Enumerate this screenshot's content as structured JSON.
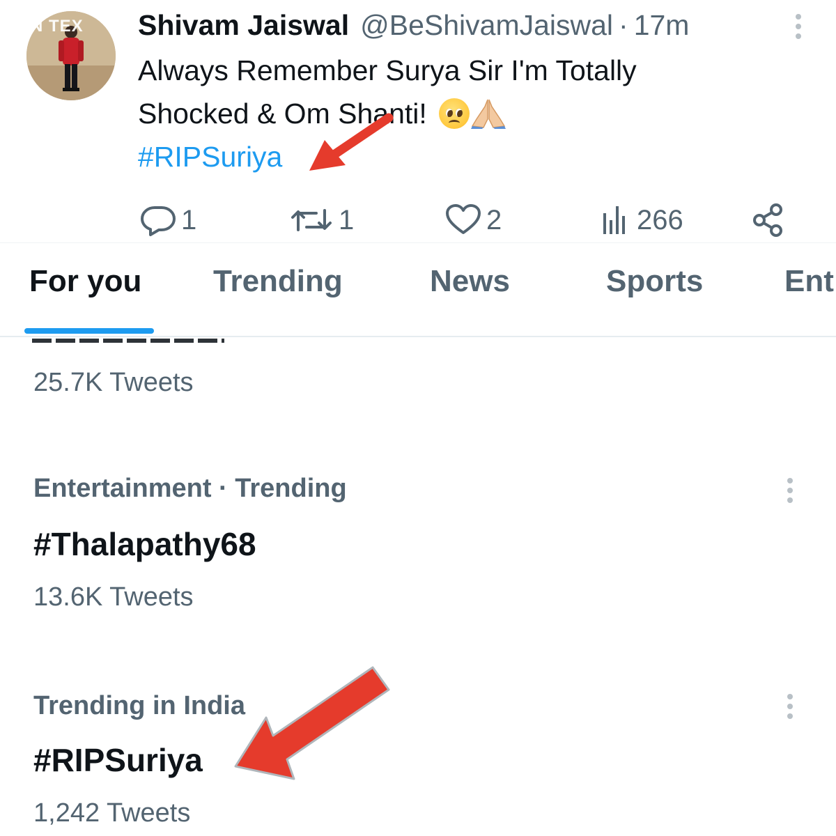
{
  "watermark": "N TEX",
  "tweet": {
    "author_name": "Shivam Jaiswal",
    "author_handle": "@BeShivamJaiswal",
    "separator": "·",
    "time_ago": "17m",
    "text_line_1": "Always Remember Surya Sir I'm Totally",
    "text_line_2": "Shocked & Om Shanti!",
    "hashtag": "#RIPSuriya",
    "emojis": [
      "pleading-face",
      "folded-hands"
    ],
    "replies": "1",
    "retweets": "1",
    "likes": "2",
    "views": "266"
  },
  "tabs": {
    "items": [
      {
        "label": "For you",
        "active": true
      },
      {
        "label": "Trending",
        "active": false
      },
      {
        "label": "News",
        "active": false
      },
      {
        "label": "Sports",
        "active": false
      },
      {
        "label": "Ent",
        "active": false
      }
    ]
  },
  "trends": [
    {
      "context": "",
      "name": "",
      "count": "25.7K Tweets"
    },
    {
      "context": "Entertainment · Trending",
      "name": "#Thalapathy68",
      "count": "13.6K Tweets"
    },
    {
      "context": "Trending in India",
      "name": "#RIPSuriya",
      "count": "1,242 Tweets"
    }
  ],
  "colors": {
    "accent": "#1d9bf0",
    "text": "#0f1419",
    "secondary": "#536471",
    "annotation_arrow": "#e53b2c"
  },
  "icons": [
    "more-vertical-icon",
    "reply-icon",
    "retweet-icon",
    "like-icon",
    "views-icon",
    "share-icon"
  ]
}
